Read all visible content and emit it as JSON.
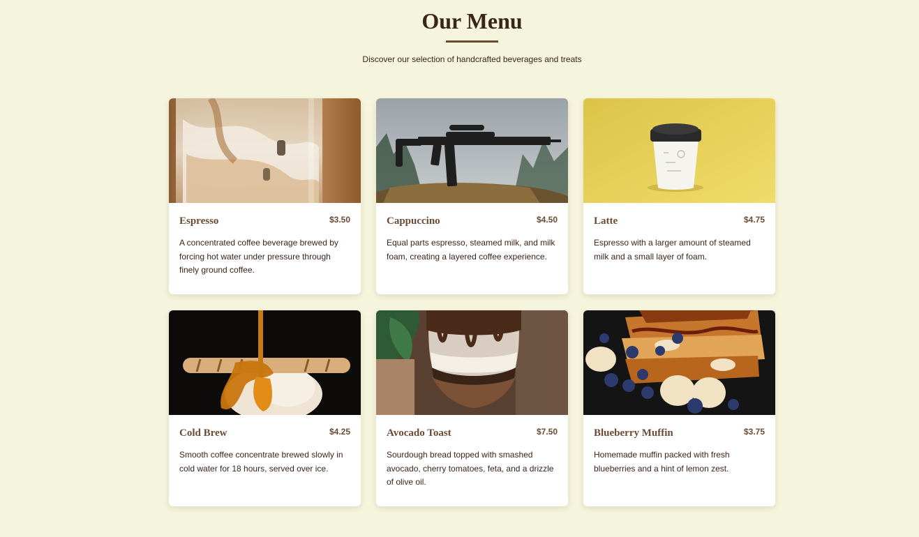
{
  "header": {
    "title": "Our Menu",
    "subtitle": "Discover our selection of handcrafted beverages and treats"
  },
  "colors": {
    "background": "#f5f4dc",
    "accent": "#6b4a34",
    "text": "#3b2418",
    "card": "#ffffff"
  },
  "menu": {
    "items": [
      {
        "name": "Espresso",
        "price": "$3.50",
        "description": "A concentrated coffee beverage brewed by forcing hot water under pressure through finely ground coffee.",
        "image": "iced-coffee-photo"
      },
      {
        "name": "Cappuccino",
        "price": "$4.50",
        "description": "Equal parts espresso, steamed milk, and milk foam, creating a layered coffee experience.",
        "image": "rifle-on-stump-photo"
      },
      {
        "name": "Latte",
        "price": "$4.75",
        "description": "Espresso with a larger amount of steamed milk and a small layer of foam.",
        "image": "paper-cup-on-yellow-photo"
      },
      {
        "name": "Cold Brew",
        "price": "$4.25",
        "description": "Smooth coffee concentrate brewed slowly in cold water for 18 hours, served over ice.",
        "image": "ice-cream-caramel-photo"
      },
      {
        "name": "Avocado Toast",
        "price": "$7.50",
        "description": "Sourdough bread topped with smashed avocado, cherry tomatoes, feta, and a drizzle of olive oil.",
        "image": "chocolate-parfait-photo"
      },
      {
        "name": "Blueberry Muffin",
        "price": "$3.75",
        "description": "Homemade muffin packed with fresh blueberries and a hint of lemon zest.",
        "image": "french-toast-berries-photo"
      }
    ]
  }
}
